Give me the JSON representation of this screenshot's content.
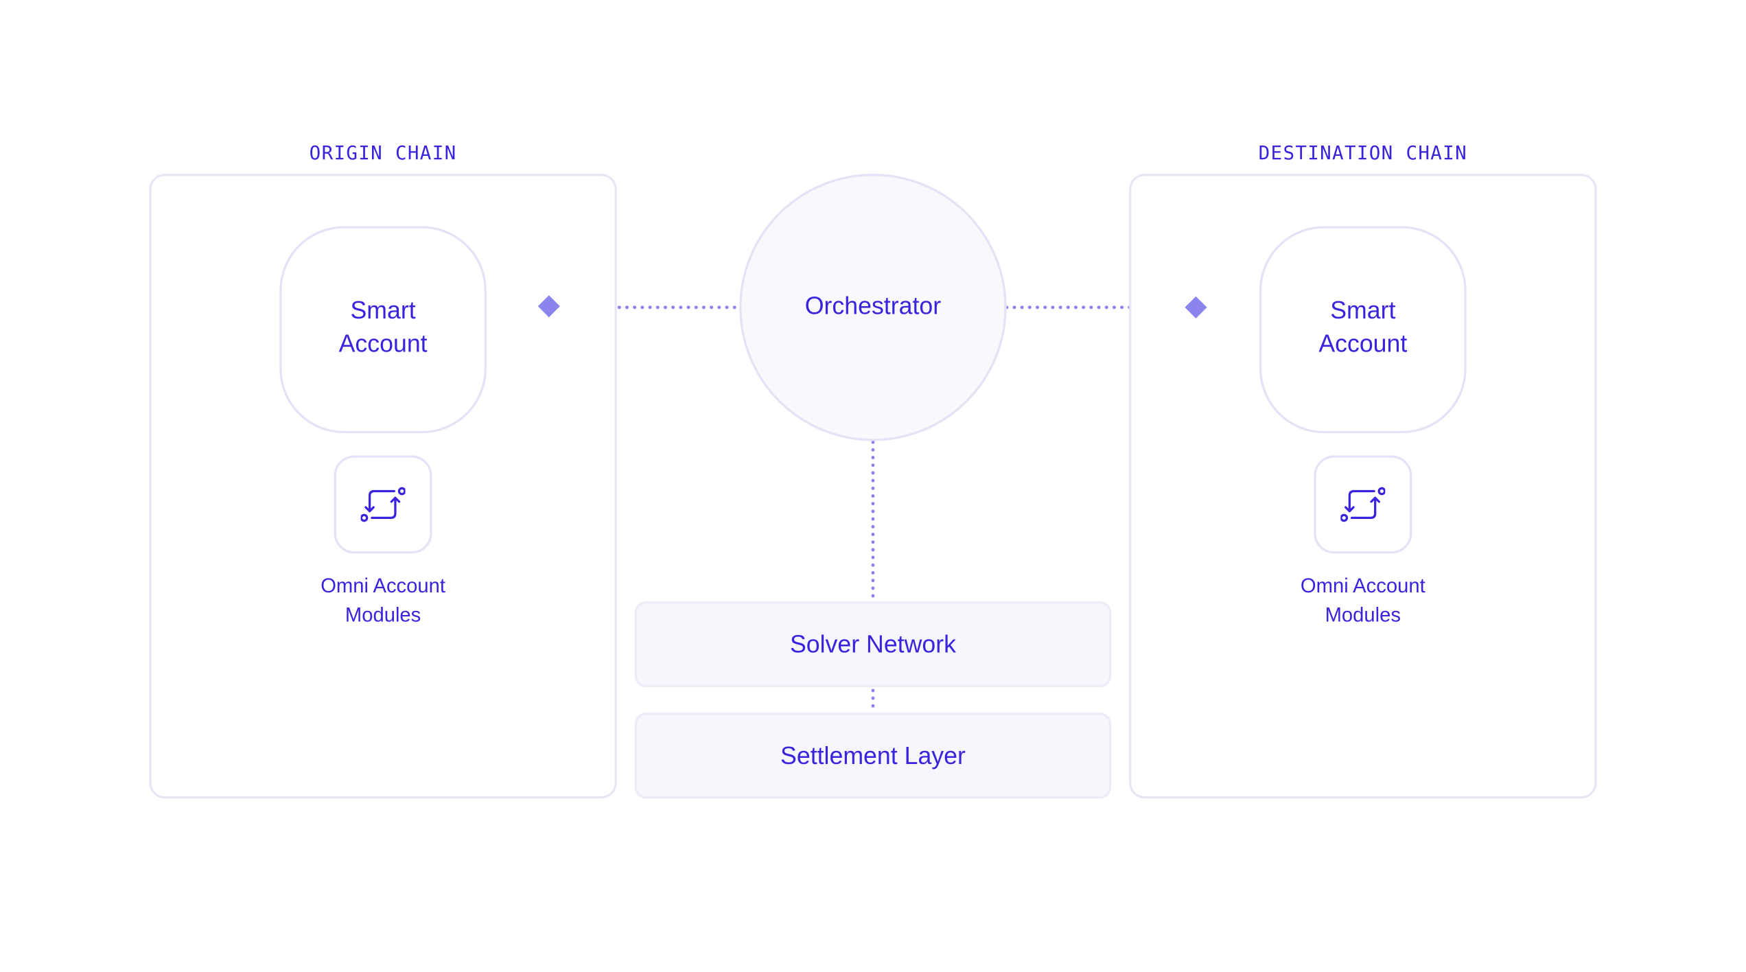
{
  "diagram": {
    "origin": {
      "title": "ORIGIN CHAIN",
      "smart_account": "Smart\nAccount",
      "modules_label": "Omni Account\nModules"
    },
    "destination": {
      "title": "DESTINATION CHAIN",
      "smart_account": "Smart\nAccount",
      "modules_label": "Omni Account\nModules"
    },
    "orchestrator": "Orchestrator",
    "solver_network": "Solver Network",
    "settlement_layer": "Settlement Layer"
  },
  "colors": {
    "accent_text": "#3a23dd",
    "connector": "#8b84ec",
    "border": "#e4e2f6",
    "layer_fill": "#f6f6fc"
  },
  "icons": {
    "module": "route-arrows-icon",
    "endpoint": "diamond-marker-icon"
  }
}
